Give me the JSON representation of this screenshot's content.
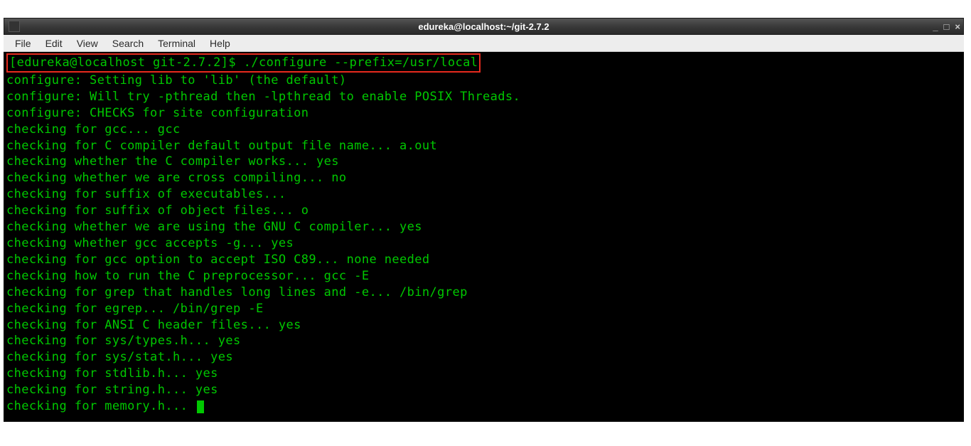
{
  "window": {
    "title": "edureka@localhost:~/git-2.7.2"
  },
  "menu": {
    "items": [
      "File",
      "Edit",
      "View",
      "Search",
      "Terminal",
      "Help"
    ]
  },
  "terminal": {
    "prompt": "[edureka@localhost git-2.7.2]$ ./configure --prefix=/usr/local",
    "lines": [
      "configure: Setting lib to 'lib' (the default)",
      "configure: Will try -pthread then -lpthread to enable POSIX Threads.",
      "configure: CHECKS for site configuration",
      "checking for gcc... gcc",
      "checking for C compiler default output file name... a.out",
      "checking whether the C compiler works... yes",
      "checking whether we are cross compiling... no",
      "checking for suffix of executables...",
      "checking for suffix of object files... o",
      "checking whether we are using the GNU C compiler... yes",
      "checking whether gcc accepts -g... yes",
      "checking for gcc option to accept ISO C89... none needed",
      "checking how to run the C preprocessor... gcc -E",
      "checking for grep that handles long lines and -e... /bin/grep",
      "checking for egrep... /bin/grep -E",
      "checking for ANSI C header files... yes",
      "checking for sys/types.h... yes",
      "checking for sys/stat.h... yes",
      "checking for stdlib.h... yes",
      "checking for string.h... yes"
    ],
    "last_line": "checking for memory.h... "
  }
}
